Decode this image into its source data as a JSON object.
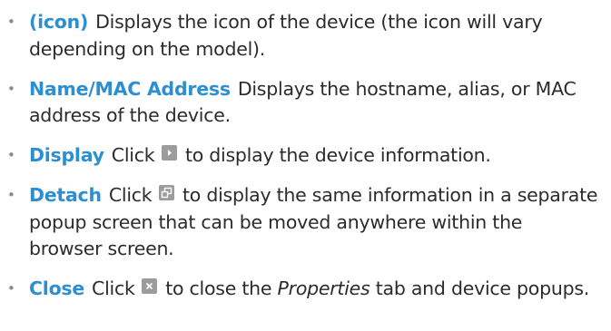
{
  "items": [
    {
      "term": "(icon)",
      "text": "Displays the icon of the device (the icon will vary depending on the model)."
    },
    {
      "term": "Name/MAC Address",
      "text": "Displays the hostname, alias, or MAC address of the device."
    },
    {
      "term": "Display",
      "text_before": "Click",
      "icon": "play-arrow-icon",
      "text_after": "to display the device information."
    },
    {
      "term": "Detach",
      "text_before": "Click",
      "icon": "detach-window-icon",
      "text_after": "to display the same information in a separate popup screen that can be moved anywhere within the browser screen."
    },
    {
      "term": "Close",
      "text_before": "Click",
      "icon": "close-x-icon",
      "text_after_1": "to close the",
      "text_italic": "Properties",
      "text_after_2": "tab and device popups."
    }
  ],
  "bullet": "•",
  "colors": {
    "term": "#2b8fd1",
    "text": "#2b2b2b",
    "icon_bg": "#9c9c9c"
  }
}
